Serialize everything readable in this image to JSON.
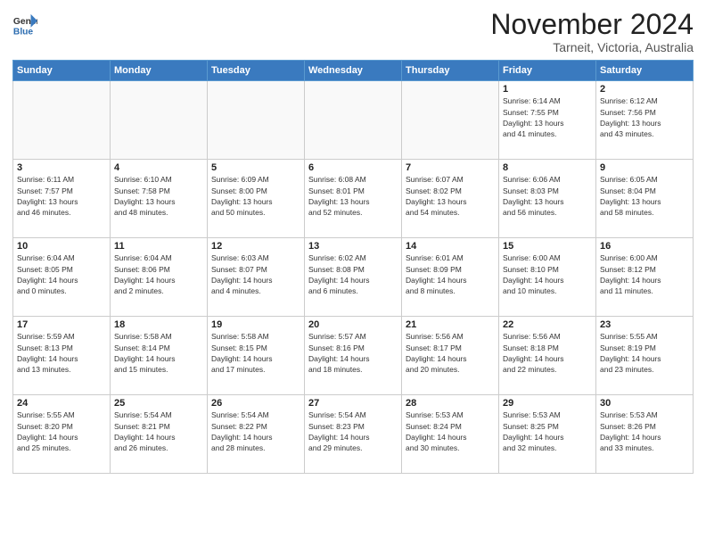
{
  "header": {
    "logo_general": "General",
    "logo_blue": "Blue",
    "month_title": "November 2024",
    "location": "Tarneit, Victoria, Australia"
  },
  "calendar": {
    "headers": [
      "Sunday",
      "Monday",
      "Tuesday",
      "Wednesday",
      "Thursday",
      "Friday",
      "Saturday"
    ],
    "weeks": [
      [
        {
          "day": "",
          "info": ""
        },
        {
          "day": "",
          "info": ""
        },
        {
          "day": "",
          "info": ""
        },
        {
          "day": "",
          "info": ""
        },
        {
          "day": "",
          "info": ""
        },
        {
          "day": "1",
          "info": "Sunrise: 6:14 AM\nSunset: 7:55 PM\nDaylight: 13 hours\nand 41 minutes."
        },
        {
          "day": "2",
          "info": "Sunrise: 6:12 AM\nSunset: 7:56 PM\nDaylight: 13 hours\nand 43 minutes."
        }
      ],
      [
        {
          "day": "3",
          "info": "Sunrise: 6:11 AM\nSunset: 7:57 PM\nDaylight: 13 hours\nand 46 minutes."
        },
        {
          "day": "4",
          "info": "Sunrise: 6:10 AM\nSunset: 7:58 PM\nDaylight: 13 hours\nand 48 minutes."
        },
        {
          "day": "5",
          "info": "Sunrise: 6:09 AM\nSunset: 8:00 PM\nDaylight: 13 hours\nand 50 minutes."
        },
        {
          "day": "6",
          "info": "Sunrise: 6:08 AM\nSunset: 8:01 PM\nDaylight: 13 hours\nand 52 minutes."
        },
        {
          "day": "7",
          "info": "Sunrise: 6:07 AM\nSunset: 8:02 PM\nDaylight: 13 hours\nand 54 minutes."
        },
        {
          "day": "8",
          "info": "Sunrise: 6:06 AM\nSunset: 8:03 PM\nDaylight: 13 hours\nand 56 minutes."
        },
        {
          "day": "9",
          "info": "Sunrise: 6:05 AM\nSunset: 8:04 PM\nDaylight: 13 hours\nand 58 minutes."
        }
      ],
      [
        {
          "day": "10",
          "info": "Sunrise: 6:04 AM\nSunset: 8:05 PM\nDaylight: 14 hours\nand 0 minutes."
        },
        {
          "day": "11",
          "info": "Sunrise: 6:04 AM\nSunset: 8:06 PM\nDaylight: 14 hours\nand 2 minutes."
        },
        {
          "day": "12",
          "info": "Sunrise: 6:03 AM\nSunset: 8:07 PM\nDaylight: 14 hours\nand 4 minutes."
        },
        {
          "day": "13",
          "info": "Sunrise: 6:02 AM\nSunset: 8:08 PM\nDaylight: 14 hours\nand 6 minutes."
        },
        {
          "day": "14",
          "info": "Sunrise: 6:01 AM\nSunset: 8:09 PM\nDaylight: 14 hours\nand 8 minutes."
        },
        {
          "day": "15",
          "info": "Sunrise: 6:00 AM\nSunset: 8:10 PM\nDaylight: 14 hours\nand 10 minutes."
        },
        {
          "day": "16",
          "info": "Sunrise: 6:00 AM\nSunset: 8:12 PM\nDaylight: 14 hours\nand 11 minutes."
        }
      ],
      [
        {
          "day": "17",
          "info": "Sunrise: 5:59 AM\nSunset: 8:13 PM\nDaylight: 14 hours\nand 13 minutes."
        },
        {
          "day": "18",
          "info": "Sunrise: 5:58 AM\nSunset: 8:14 PM\nDaylight: 14 hours\nand 15 minutes."
        },
        {
          "day": "19",
          "info": "Sunrise: 5:58 AM\nSunset: 8:15 PM\nDaylight: 14 hours\nand 17 minutes."
        },
        {
          "day": "20",
          "info": "Sunrise: 5:57 AM\nSunset: 8:16 PM\nDaylight: 14 hours\nand 18 minutes."
        },
        {
          "day": "21",
          "info": "Sunrise: 5:56 AM\nSunset: 8:17 PM\nDaylight: 14 hours\nand 20 minutes."
        },
        {
          "day": "22",
          "info": "Sunrise: 5:56 AM\nSunset: 8:18 PM\nDaylight: 14 hours\nand 22 minutes."
        },
        {
          "day": "23",
          "info": "Sunrise: 5:55 AM\nSunset: 8:19 PM\nDaylight: 14 hours\nand 23 minutes."
        }
      ],
      [
        {
          "day": "24",
          "info": "Sunrise: 5:55 AM\nSunset: 8:20 PM\nDaylight: 14 hours\nand 25 minutes."
        },
        {
          "day": "25",
          "info": "Sunrise: 5:54 AM\nSunset: 8:21 PM\nDaylight: 14 hours\nand 26 minutes."
        },
        {
          "day": "26",
          "info": "Sunrise: 5:54 AM\nSunset: 8:22 PM\nDaylight: 14 hours\nand 28 minutes."
        },
        {
          "day": "27",
          "info": "Sunrise: 5:54 AM\nSunset: 8:23 PM\nDaylight: 14 hours\nand 29 minutes."
        },
        {
          "day": "28",
          "info": "Sunrise: 5:53 AM\nSunset: 8:24 PM\nDaylight: 14 hours\nand 30 minutes."
        },
        {
          "day": "29",
          "info": "Sunrise: 5:53 AM\nSunset: 8:25 PM\nDaylight: 14 hours\nand 32 minutes."
        },
        {
          "day": "30",
          "info": "Sunrise: 5:53 AM\nSunset: 8:26 PM\nDaylight: 14 hours\nand 33 minutes."
        }
      ]
    ]
  }
}
